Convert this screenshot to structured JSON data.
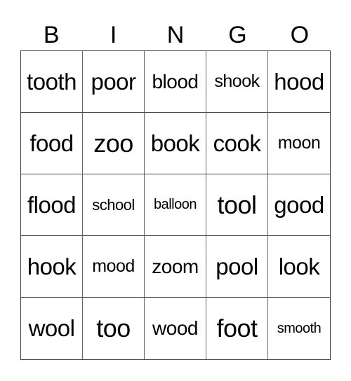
{
  "header": {
    "letters": [
      "B",
      "I",
      "N",
      "G",
      "O"
    ]
  },
  "card": {
    "rows": [
      [
        "tooth",
        "poor",
        "blood",
        "shook",
        "hood"
      ],
      [
        "food",
        "zoo",
        "book",
        "cook",
        "moon"
      ],
      [
        "flood",
        "school",
        "balloon",
        "tool",
        "good"
      ],
      [
        "hook",
        "mood",
        "zoom",
        "pool",
        "look"
      ],
      [
        "wool",
        "too",
        "wood",
        "foot",
        "smooth"
      ]
    ]
  }
}
